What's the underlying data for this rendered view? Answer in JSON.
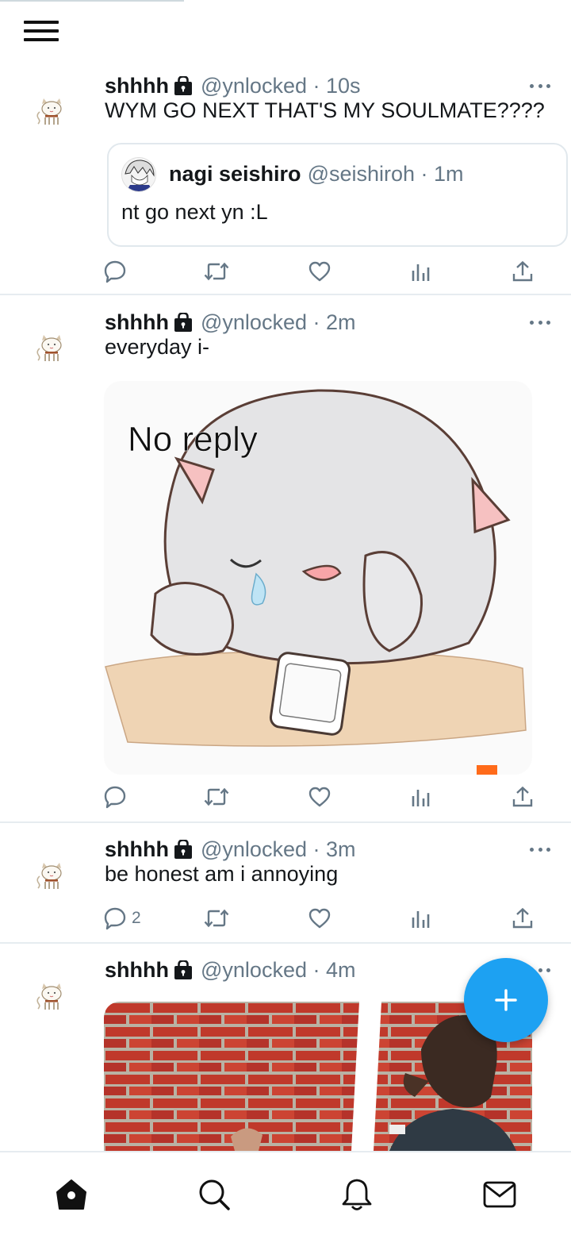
{
  "header": {
    "menu_icon": "hamburger-menu-icon"
  },
  "tweets": [
    {
      "name": "shhhh",
      "handle": "@ynlocked",
      "time": "10s",
      "text": "WYM GO NEXT THAT'S MY SOULMATE????",
      "quoted": {
        "name": "nagi seishiro",
        "handle": "@seishiroh",
        "time": "1m",
        "text": "nt go next yn :L"
      },
      "reply_count": ""
    },
    {
      "name": "shhhh",
      "handle": "@ynlocked",
      "time": "2m",
      "text": "everyday i-",
      "media_caption": "No reply",
      "reply_count": ""
    },
    {
      "name": "shhhh",
      "handle": "@ynlocked",
      "time": "3m",
      "text": "be honest am i annoying",
      "reply_count": "2"
    },
    {
      "name": "shhhh",
      "handle": "@ynlocked",
      "time": "4m",
      "text": ""
    }
  ],
  "bottom_nav": [
    "home-icon",
    "search-icon",
    "notifications-icon",
    "messages-icon"
  ],
  "colors": {
    "accent": "#1da1f2",
    "secondary_text": "#657786",
    "divider": "#e6ecf0"
  }
}
